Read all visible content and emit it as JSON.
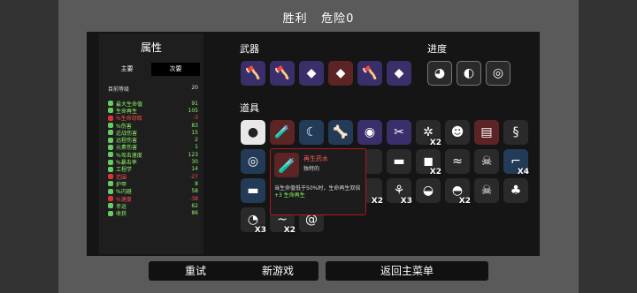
{
  "header": {
    "title": "胜利",
    "danger": "危险0"
  },
  "stats": {
    "title": "属性",
    "tabs": [
      "主要",
      "次要"
    ],
    "level_label": "目前等级",
    "level_value": "20",
    "rows": [
      {
        "label": "最大生命值",
        "value": "91",
        "color": "green",
        "icon": "heart-icon"
      },
      {
        "label": "生命再生",
        "value": "105",
        "color": "green",
        "icon": "regen-icon"
      },
      {
        "label": "%生命窃取",
        "value": "-3",
        "color": "red",
        "icon": "lifesteal-icon"
      },
      {
        "label": "%伤害",
        "value": "83",
        "color": "green",
        "icon": "damage-icon"
      },
      {
        "label": "近战伤害",
        "value": "15",
        "color": "green",
        "icon": "melee-icon"
      },
      {
        "label": "远程伤害",
        "value": "2",
        "color": "green",
        "icon": "ranged-icon"
      },
      {
        "label": "元素伤害",
        "value": "1",
        "color": "green",
        "icon": "elemental-icon"
      },
      {
        "label": "%攻击速度",
        "value": "123",
        "color": "green",
        "icon": "attack-speed-icon"
      },
      {
        "label": "%暴击率",
        "value": "30",
        "color": "green",
        "icon": "crit-icon"
      },
      {
        "label": "工程学",
        "value": "14",
        "color": "green",
        "icon": "engineering-icon"
      },
      {
        "label": "范围",
        "value": "-27",
        "color": "red",
        "icon": "range-icon"
      },
      {
        "label": "护甲",
        "value": "8",
        "color": "green",
        "icon": "armor-icon"
      },
      {
        "label": "%闪避",
        "value": "58",
        "color": "green",
        "icon": "dodge-icon"
      },
      {
        "label": "%速度",
        "value": "-38",
        "color": "red",
        "icon": "speed-icon"
      },
      {
        "label": "幸运",
        "value": "62",
        "color": "green",
        "icon": "luck-icon"
      },
      {
        "label": "收获",
        "value": "86",
        "color": "green",
        "icon": "harvest-icon"
      }
    ]
  },
  "weapons": {
    "title": "武器",
    "items": [
      {
        "icon": "axe-icon",
        "glyph": "🪓",
        "tone": "p"
      },
      {
        "icon": "axe-icon",
        "glyph": "🪓",
        "tone": "p"
      },
      {
        "icon": "crystal-icon",
        "glyph": "◆",
        "tone": "p"
      },
      {
        "icon": "crystal-icon",
        "glyph": "◆",
        "tone": "r"
      },
      {
        "icon": "axe-icon",
        "glyph": "🪓",
        "tone": "p"
      },
      {
        "icon": "crystal-icon",
        "glyph": "◆",
        "tone": "p"
      }
    ]
  },
  "progress": {
    "title": "进度",
    "items": [
      {
        "icon": "alien-egg-icon",
        "glyph": "◕"
      },
      {
        "icon": "spotted-egg-icon",
        "glyph": "◐"
      },
      {
        "icon": "disc-icon",
        "glyph": "◎"
      }
    ]
  },
  "items": {
    "title": "道具",
    "rows": [
      [
        {
          "icon": "egg-icon",
          "glyph": "●",
          "tone": "w"
        },
        {
          "icon": "regen-potion-icon",
          "glyph": "🧪",
          "tone": "r"
        },
        {
          "icon": "claw-icon",
          "glyph": "☾",
          "tone": "b"
        },
        {
          "icon": "bone-icon",
          "glyph": "🦴",
          "tone": "b"
        },
        {
          "icon": "lips-icon",
          "glyph": "◉",
          "tone": "p"
        },
        {
          "icon": "scissors-icon",
          "glyph": "✂",
          "tone": "p"
        },
        {
          "icon": "spider-icon",
          "glyph": "✲",
          "tone": "",
          "count": "X2"
        },
        {
          "icon": "robot-icon",
          "glyph": "☻",
          "tone": ""
        },
        {
          "icon": "book-icon",
          "glyph": "▤",
          "tone": "r"
        },
        {
          "icon": "ghost-icon",
          "glyph": "§",
          "tone": ""
        }
      ],
      [
        {
          "icon": "ring-icon",
          "glyph": "◎",
          "tone": "b"
        },
        {
          "icon": "",
          "glyph": "",
          "tone": "b"
        },
        {
          "icon": "",
          "glyph": "",
          "tone": ""
        },
        {
          "icon": "",
          "glyph": "",
          "tone": ""
        },
        {
          "icon": "",
          "glyph": "",
          "tone": ""
        },
        {
          "icon": "gun-icon",
          "glyph": "▬",
          "tone": ""
        },
        {
          "icon": "metal-plate-icon",
          "glyph": "◼",
          "tone": "",
          "count": "X2"
        },
        {
          "icon": "worm-icon",
          "glyph": "≈",
          "tone": ""
        },
        {
          "icon": "skeleton-icon",
          "glyph": "☠",
          "tone": ""
        },
        {
          "icon": "crane-icon",
          "glyph": "⌐",
          "tone": "b",
          "count": "X4"
        }
      ],
      [
        {
          "icon": "bread-icon",
          "glyph": "▬",
          "tone": "b"
        },
        {
          "icon": "",
          "glyph": "",
          "tone": ""
        },
        {
          "icon": "",
          "glyph": "",
          "tone": ""
        },
        {
          "icon": "",
          "glyph": "",
          "tone": ""
        },
        {
          "icon": "",
          "glyph": "",
          "tone": "",
          "count": "X2"
        },
        {
          "icon": "sprout-icon",
          "glyph": "⚘",
          "tone": "",
          "count": "X3"
        },
        {
          "icon": "helmet-icon",
          "glyph": "◒",
          "tone": ""
        },
        {
          "icon": "dome-icon",
          "glyph": "◓",
          "tone": "",
          "count": "X2"
        },
        {
          "icon": "skull-icon",
          "glyph": "☠",
          "tone": ""
        },
        {
          "icon": "mushroom-icon",
          "glyph": "♣",
          "tone": ""
        }
      ],
      [
        {
          "icon": "eye-cap-icon",
          "glyph": "◔",
          "tone": "",
          "count": "X3"
        },
        {
          "icon": "worm-small-icon",
          "glyph": "~",
          "tone": "",
          "count": "X2"
        },
        {
          "icon": "snail-icon",
          "glyph": "@",
          "tone": ""
        }
      ]
    ]
  },
  "tooltip": {
    "name": "再生药水",
    "type": "独特的",
    "desc": "当生命值低于50%时，生命再生双倍",
    "bonus": "+3 生命再生"
  },
  "buttons": {
    "retry": "重试",
    "new_game": "新游戏",
    "main_menu": "返回主菜单"
  }
}
